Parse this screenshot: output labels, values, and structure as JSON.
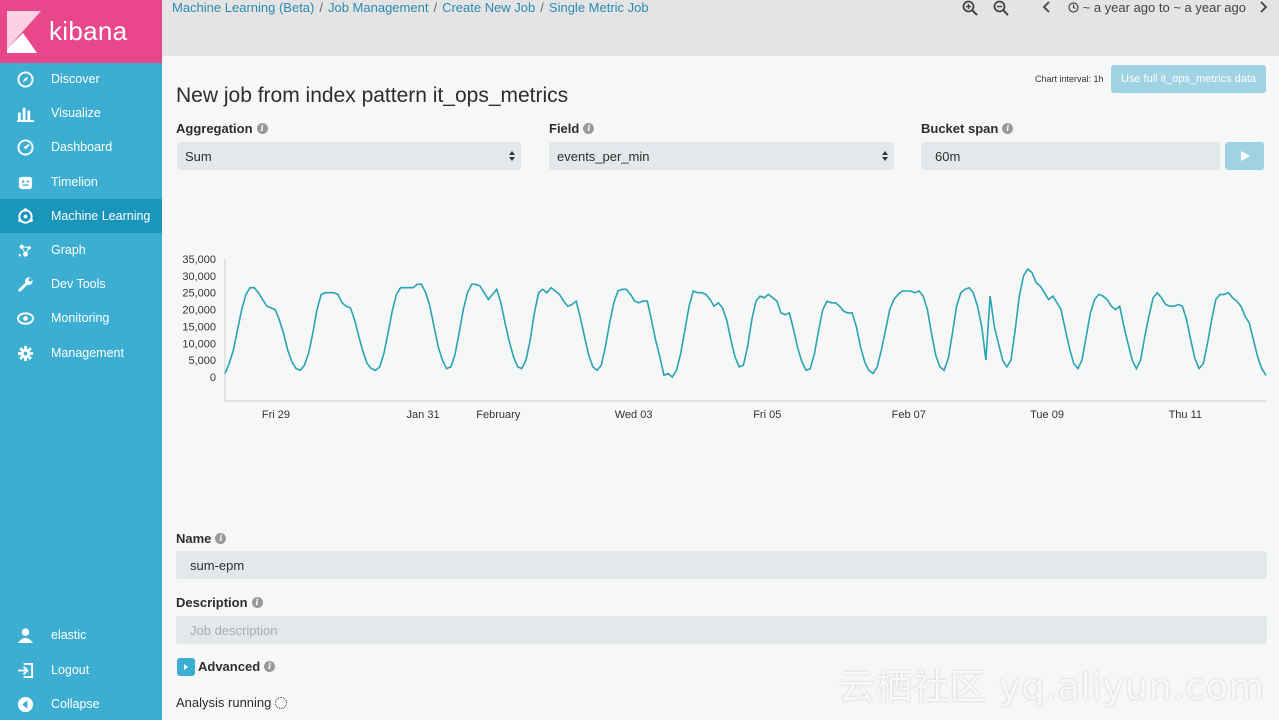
{
  "app": {
    "logo_text": "kibana"
  },
  "sidebar": {
    "items": [
      {
        "label": "Discover",
        "icon": "compass-icon"
      },
      {
        "label": "Visualize",
        "icon": "bar-chart-icon"
      },
      {
        "label": "Dashboard",
        "icon": "dashboard-icon"
      },
      {
        "label": "Timelion",
        "icon": "timelion-icon"
      },
      {
        "label": "Machine Learning",
        "icon": "machine-learning-icon",
        "active": true
      },
      {
        "label": "Graph",
        "icon": "graph-icon"
      },
      {
        "label": "Dev Tools",
        "icon": "wrench-icon"
      },
      {
        "label": "Monitoring",
        "icon": "eye-icon"
      },
      {
        "label": "Management",
        "icon": "gear-icon"
      }
    ],
    "bottom_items": [
      {
        "label": "elastic",
        "icon": "user-icon"
      },
      {
        "label": "Logout",
        "icon": "logout-icon"
      },
      {
        "label": "Collapse",
        "icon": "collapse-icon"
      }
    ]
  },
  "breadcrumb": [
    "Machine Learning (Beta)",
    "Job Management",
    "Create New Job",
    "Single Metric Job"
  ],
  "time_range": "~ a year ago to ~ a year ago",
  "page": {
    "title": "New job from index pattern it_ops_metrics",
    "chart_interval": "Chart interval: 1h",
    "use_full_button": "Use full it_ops_metrics data"
  },
  "form": {
    "aggregation": {
      "label": "Aggregation",
      "value": "Sum"
    },
    "field": {
      "label": "Field",
      "value": "events_per_min"
    },
    "bucket_span": {
      "label": "Bucket span",
      "value": "60m"
    },
    "name": {
      "label": "Name",
      "value": "sum-epm"
    },
    "description": {
      "label": "Description",
      "placeholder": "Job description"
    },
    "advanced": {
      "label": "Advanced"
    },
    "status": "Analysis running"
  },
  "colors": {
    "sidebar": "#3caed2",
    "logo": "#e8488b",
    "line": "#2aa3b3",
    "link": "#2a8bb3"
  },
  "watermark": "云栖社区 yq.aliyun.com",
  "chart_data": {
    "type": "line",
    "ylim": [
      0,
      35000
    ],
    "yticks": [
      0,
      5000,
      10000,
      15000,
      20000,
      25000,
      30000,
      35000
    ],
    "ytick_labels": [
      "0",
      "5,000",
      "10,000",
      "15,000",
      "20,000",
      "25,000",
      "30,000",
      "35,000"
    ],
    "xticks": [
      {
        "label": "Fri 29",
        "at": 0.021
      },
      {
        "label": "Jan 31",
        "at": 0.16
      },
      {
        "label": "February",
        "at": 0.227
      },
      {
        "label": "Wed 03",
        "at": 0.36
      },
      {
        "label": "Fri 05",
        "at": 0.493
      },
      {
        "label": "Feb 07",
        "at": 0.626
      },
      {
        "label": "Tue 09",
        "at": 0.759
      },
      {
        "label": "Thu 11",
        "at": 0.892
      }
    ],
    "series": [
      {
        "values": [
          1000,
          4000,
          8000,
          14000,
          20000,
          24500,
          26500,
          26500,
          25000,
          23000,
          21000,
          20500,
          20000,
          17000,
          13000,
          8000,
          4500,
          2500,
          2000,
          3500,
          7000,
          13000,
          20000,
          24500,
          25000,
          25000,
          25000,
          24500,
          22000,
          21000,
          20500,
          17000,
          12000,
          7500,
          4000,
          2500,
          2000,
          3000,
          7000,
          13000,
          19500,
          24500,
          26500,
          26500,
          26500,
          26500,
          27500,
          27500,
          25000,
          21000,
          15000,
          9000,
          5000,
          2500,
          3000,
          6500,
          13000,
          20000,
          25000,
          27500,
          27500,
          27000,
          25000,
          23000,
          24500,
          26000,
          22000,
          16000,
          10500,
          6000,
          3000,
          2500,
          5000,
          11000,
          19000,
          25000,
          26000,
          25000,
          26500,
          25500,
          24500,
          22500,
          21000,
          21500,
          22500,
          17500,
          12000,
          6500,
          3000,
          2000,
          3500,
          9000,
          16000,
          22000,
          25500,
          26000,
          26000,
          24500,
          22500,
          22000,
          22500,
          22500,
          17000,
          11000,
          6000,
          500,
          1000,
          0,
          2000,
          7000,
          14000,
          21000,
          25500,
          25000,
          25000,
          24500,
          23000,
          21000,
          22000,
          20500,
          17000,
          11000,
          6000,
          3000,
          3500,
          9000,
          17000,
          22500,
          24000,
          23500,
          24500,
          23500,
          22500,
          19000,
          18500,
          19000,
          14000,
          8500,
          4500,
          2000,
          2500,
          7000,
          14000,
          20000,
          22500,
          22000,
          22000,
          21000,
          19500,
          19000,
          19000,
          15000,
          9000,
          4500,
          2000,
          1000,
          3000,
          8000,
          14000,
          20000,
          23000,
          24500,
          25500,
          25500,
          25500,
          25000,
          25500,
          24000,
          20000,
          13000,
          6500,
          3000,
          2000,
          5500,
          13000,
          21000,
          25000,
          26000,
          26500,
          25000,
          21000,
          15000,
          5000,
          24000,
          15000,
          10000,
          5000,
          3000,
          5000,
          14000,
          24000,
          30000,
          32000,
          31000,
          28000,
          27000,
          25000,
          23000,
          24000,
          22000,
          20000,
          14000,
          8500,
          4000,
          2500,
          5000,
          12000,
          19000,
          23000,
          24500,
          24000,
          23000,
          21000,
          20000,
          21000,
          15000,
          10000,
          5000,
          2500,
          5000,
          12000,
          18000,
          23500,
          25000,
          23500,
          21500,
          21000,
          21000,
          21500,
          21000,
          17000,
          11000,
          5500,
          2500,
          4000,
          10000,
          17000,
          23000,
          24500,
          24500,
          25000,
          23500,
          22500,
          21000,
          18000,
          16000,
          11000,
          6000,
          2500,
          500
        ]
      }
    ]
  }
}
